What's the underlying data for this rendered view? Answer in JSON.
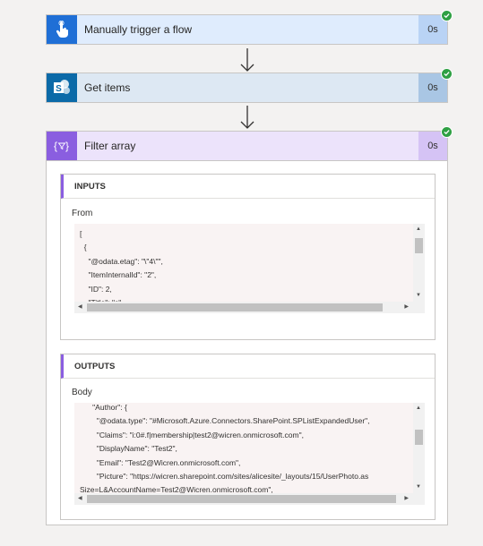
{
  "steps": [
    {
      "title": "Manually trigger a flow",
      "duration": "0s",
      "icon": "hand-touch-icon",
      "status": "succeeded"
    },
    {
      "title": "Get items",
      "duration": "0s",
      "icon": "sharepoint-icon",
      "status": "succeeded"
    },
    {
      "title": "Filter array",
      "duration": "0s",
      "icon": "filter-array-icon",
      "status": "succeeded"
    }
  ],
  "inputs": {
    "heading": "INPUTS",
    "field_label": "From",
    "lines": [
      "[",
      "  {",
      "    \"@odata.etag\": \"\\\"4\\\"\",",
      "    \"ItemInternalId\": \"2\",",
      "    \"ID\": 2,",
      "    \"Title\": \"c\","
    ]
  },
  "outputs": {
    "heading": "OUTPUTS",
    "field_label": "Body",
    "lines": [
      "      \"Author\": {",
      "        \"@odata.type\": \"#Microsoft.Azure.Connectors.SharePoint.SPListExpandedUser\",",
      "        \"Claims\": \"i:0#.f|membership|test2@wicren.onmicrosoft.com\",",
      "        \"DisplayName\": \"Test2\",",
      "        \"Email\": \"Test2@Wicren.onmicrosoft.com\",",
      "        \"Picture\": \"https://wicren.sharepoint.com/sites/alicesite/_layouts/15/UserPhoto.as",
      "Size=L&AccountName=Test2@Wicren.onmicrosoft.com\","
    ]
  },
  "colors": {
    "trigger": "#1f6fd6",
    "sharepoint": "#0b6aa8",
    "data_operation": "#8a5ee0",
    "success": "#2ea043"
  }
}
